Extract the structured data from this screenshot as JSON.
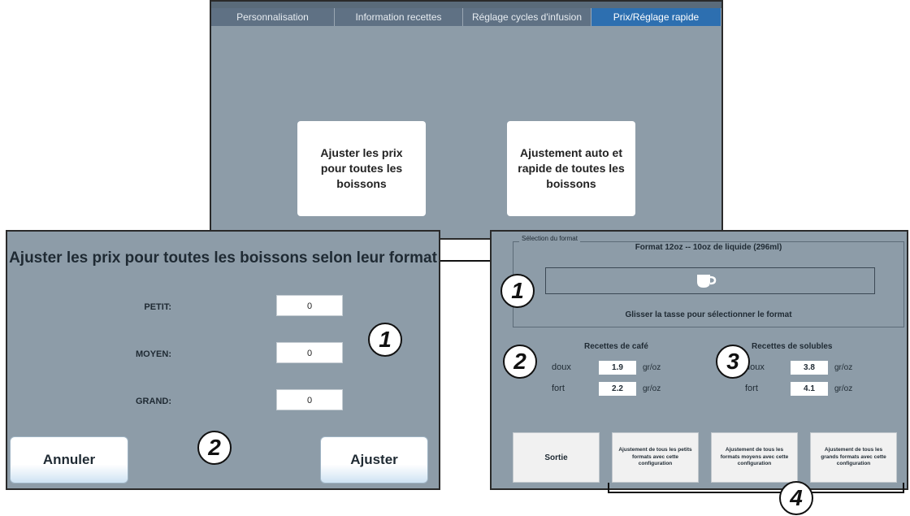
{
  "top": {
    "tabs": [
      "Personnalisation",
      "Information recettes",
      "Réglage cycles d'infusion",
      "Prix/Réglage rapide"
    ],
    "btn_adjust_prices": "Ajuster les prix pour toutes les boissons",
    "btn_auto_adjust": "Ajustement auto et rapide de toutes les boissons"
  },
  "left": {
    "title": "Ajuster les prix pour toutes les boissons selon leur format",
    "petit_label": "PETIT:",
    "petit_value": "0",
    "moyen_label": "MOYEN:",
    "moyen_value": "0",
    "grand_label": "GRAND:",
    "grand_value": "0",
    "cancel": "Annuler",
    "adjust": "Ajuster",
    "callout_1": "1",
    "callout_2": "2"
  },
  "right": {
    "legend": "Sélection du format",
    "format_title": "Format 12oz -- 10oz de liquide (296ml)",
    "hint": "Glisser la tasse pour sélectionner le format",
    "coffee_head": "Recettes de café",
    "soluble_head": "Recettes de solubles",
    "doux": "doux",
    "fort": "fort",
    "coffee_doux": "1.9",
    "coffee_fort": "2.2",
    "soluble_doux": "3.8",
    "soluble_fort": "4.1",
    "unit": "gr/oz",
    "sortie": "Sortie",
    "btn_small": "Ajustement de tous les petits formats avec cette configuration",
    "btn_medium": "Ajustement de tous les formats moyens avec cette configuration",
    "btn_large": "Ajustement de tous les grands formats avec cette configuration",
    "callout_1": "1",
    "callout_2": "2",
    "callout_3": "3",
    "callout_4": "4"
  }
}
